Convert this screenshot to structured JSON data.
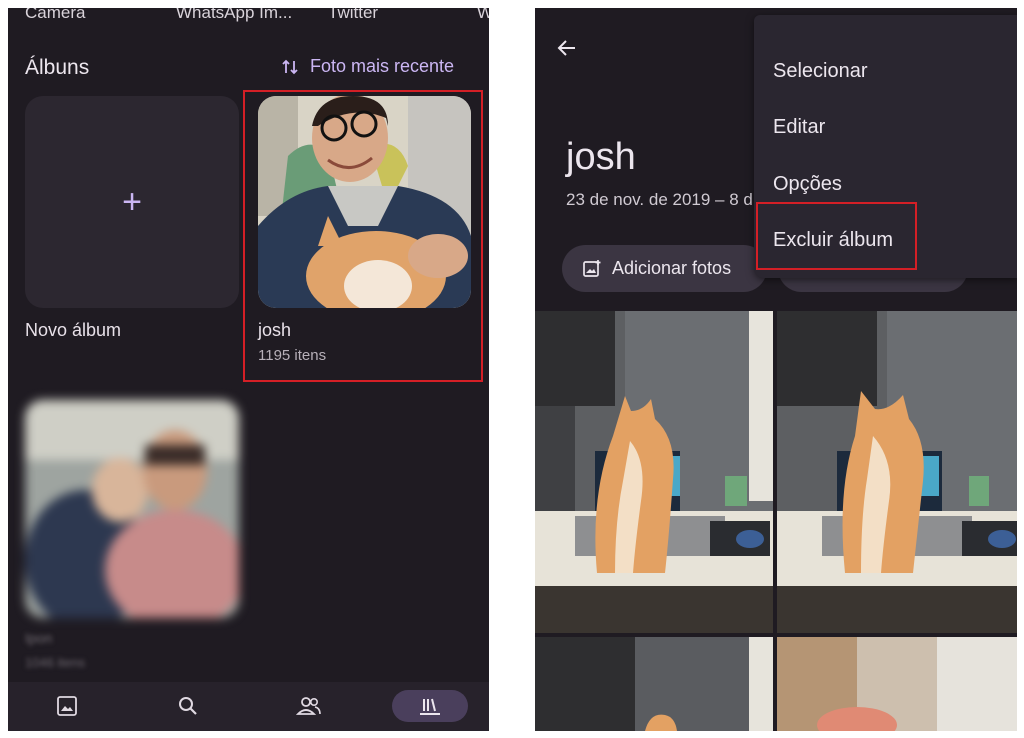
{
  "left": {
    "top_labels": [
      "Camera",
      "WhatsApp Im...",
      "Twitter",
      "W"
    ],
    "albums_title": "Álbuns",
    "sort_label": "Foto mais recente",
    "new_album_label": "Novo álbum",
    "new_album_icon": "+",
    "album": {
      "name": "josh",
      "count": "1195 itens"
    },
    "blurred_album": {
      "name": "Ipon",
      "count": "1046 itens"
    },
    "nav": [
      "photos-icon",
      "search-icon",
      "people-icon",
      "library-icon"
    ]
  },
  "right": {
    "album_title": "josh",
    "date_range": "23 de nov. de 2019 – 8 d",
    "add_photos_label": "Adicionar fotos",
    "menu": {
      "items": [
        "Selecionar",
        "Editar",
        "Opções",
        "Excluir álbum"
      ]
    }
  },
  "colors": {
    "background": "#1f1b22",
    "accent": "#cbb6f3",
    "highlight": "#d41f26",
    "tile": "#2c2730"
  }
}
